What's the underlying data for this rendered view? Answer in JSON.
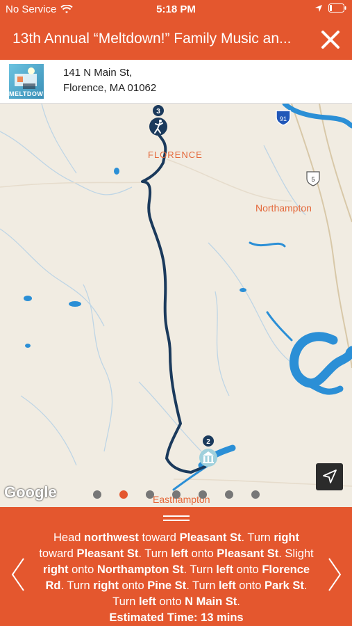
{
  "status_bar": {
    "carrier": "No Service",
    "time": "5:18 PM"
  },
  "header": {
    "title": "13th Annual “Meltdown!” Family Music an..."
  },
  "location": {
    "thumbnail_text": "MELTDOWN",
    "address_line1": "141 N Main St,",
    "address_line2": "Florence, MA 01062"
  },
  "map": {
    "labels": {
      "florence": "FLORENCE",
      "northampton": "Northampton",
      "easthampton": "Easthampton"
    },
    "route_shields": {
      "interstate": "91",
      "us_route": "5"
    },
    "markers": [
      {
        "number": "3",
        "icon": "person-icon"
      },
      {
        "number": "2",
        "icon": "building-icon"
      }
    ],
    "attribution": "Google",
    "page_dots": {
      "count": 7,
      "active_index": 1
    },
    "route_color": "#1B3A5C",
    "water_color": "#2B8FD6"
  },
  "directions": {
    "segments": [
      {
        "t": "Head "
      },
      {
        "t": "northwest",
        "b": true
      },
      {
        "t": " toward "
      },
      {
        "t": "Pleasant St",
        "b": true
      },
      {
        "t": ". Turn "
      },
      {
        "t": "right",
        "b": true
      },
      {
        "t": " toward "
      },
      {
        "t": "Pleasant St",
        "b": true
      },
      {
        "t": ". Turn "
      },
      {
        "t": "left",
        "b": true
      },
      {
        "t": " onto "
      },
      {
        "t": "Pleasant St",
        "b": true
      },
      {
        "t": ". Slight "
      },
      {
        "t": "right",
        "b": true
      },
      {
        "t": " onto "
      },
      {
        "t": "Northampton St",
        "b": true
      },
      {
        "t": ". Turn "
      },
      {
        "t": "left",
        "b": true
      },
      {
        "t": " onto "
      },
      {
        "t": "Florence Rd",
        "b": true
      },
      {
        "t": ". Turn "
      },
      {
        "t": "right",
        "b": true
      },
      {
        "t": " onto "
      },
      {
        "t": "Pine St",
        "b": true
      },
      {
        "t": ". Turn "
      },
      {
        "t": "left",
        "b": true
      },
      {
        "t": " onto "
      },
      {
        "t": "Park St",
        "b": true
      },
      {
        "t": ". Turn "
      },
      {
        "t": "left",
        "b": true
      },
      {
        "t": " onto "
      },
      {
        "t": "N Main St",
        "b": true
      },
      {
        "t": "."
      }
    ],
    "estimated_time": "Estimated Time: 13 mins"
  },
  "colors": {
    "brand": "#E4572E"
  }
}
